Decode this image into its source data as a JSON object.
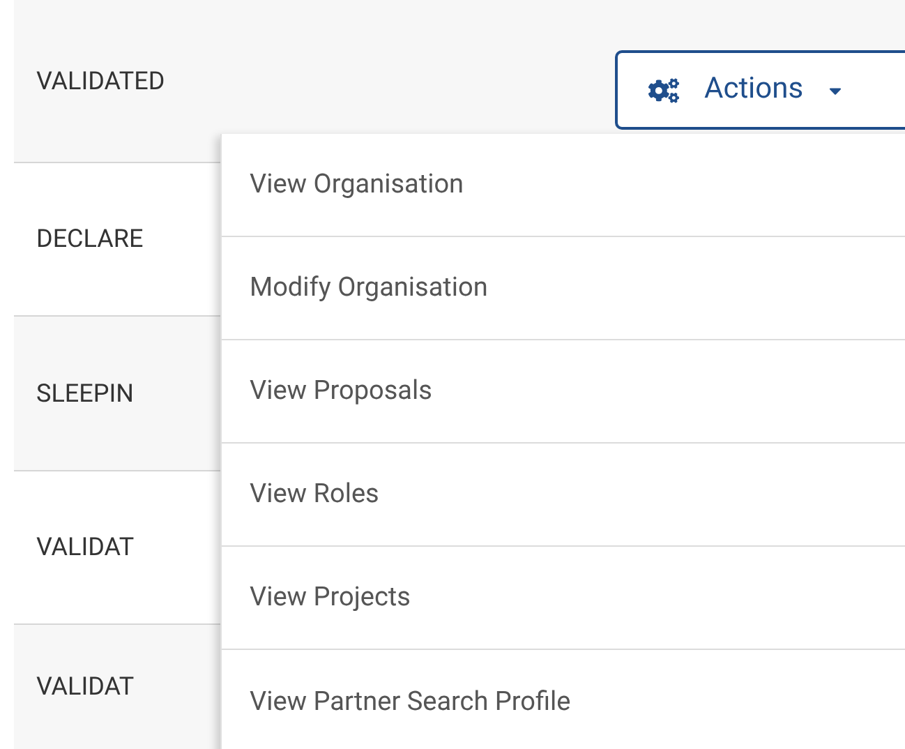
{
  "rows": [
    {
      "status": "VALIDATED"
    },
    {
      "status": "DECLARE"
    },
    {
      "status": "SLEEPIN"
    },
    {
      "status": "VALIDAT"
    },
    {
      "status": "VALIDAT"
    }
  ],
  "actions_button": {
    "label": "Actions"
  },
  "menu": {
    "items": [
      {
        "label": "View Organisation"
      },
      {
        "label": "Modify Organisation"
      },
      {
        "label": "View Proposals"
      },
      {
        "label": "View Roles"
      },
      {
        "label": "View Projects"
      },
      {
        "label": "View Partner Search Profile"
      }
    ]
  }
}
